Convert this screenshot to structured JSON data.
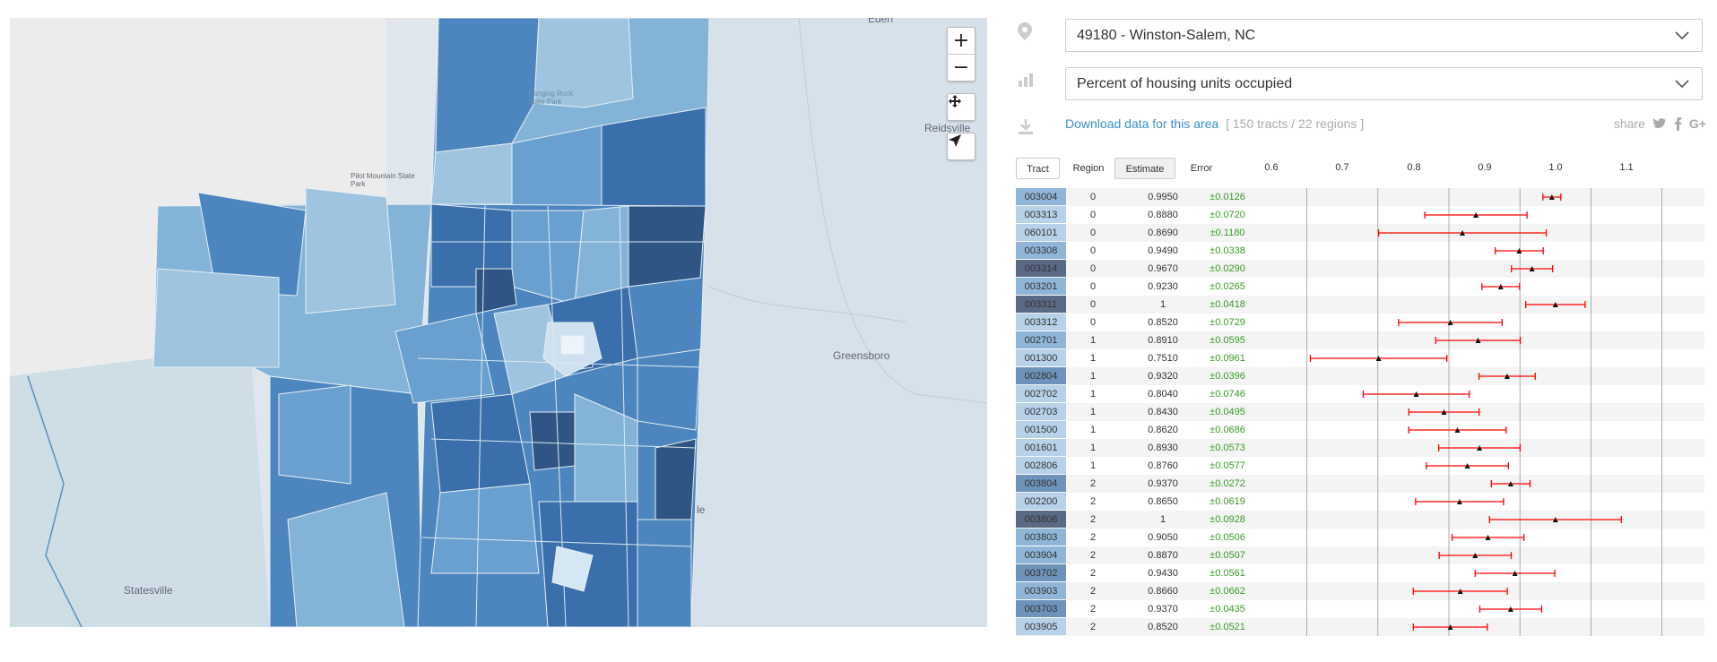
{
  "map": {
    "place_labels": [
      "Eden",
      "Reidsville",
      "Hanging Rock State Park",
      "Pilot Mountain State Park",
      "Greensboro",
      "Statesville",
      "le"
    ],
    "controls": {
      "zoom_in": "+",
      "zoom_out": "−"
    },
    "colors": {
      "water": "#d3e0e8",
      "land": "#e8e8e8",
      "c1": "#9ec4e0",
      "c2": "#84b3d8",
      "c3": "#6aa0cf",
      "c4": "#4d86bf",
      "c5": "#3a6fab",
      "c6": "#2e5584"
    }
  },
  "controls": {
    "location_select": "49180 - Winston-Salem, NC",
    "variable_select": "Percent of housing units occupied",
    "download_link": "Download data for this area",
    "download_meta": "[ 150 tracts / 22 regions ]",
    "share_label": "share",
    "share_icons": [
      "twitter-icon",
      "facebook-icon",
      "google-plus-icon"
    ]
  },
  "table": {
    "headers": {
      "tract": "Tract",
      "region": "Region",
      "estimate": "Estimate",
      "error": "Error"
    },
    "axis_ticks": [
      "0.6",
      "0.7",
      "0.8",
      "0.9",
      "1.0",
      "1.1"
    ],
    "rows": [
      {
        "tract": "003004",
        "region": "0",
        "estimate": "0.9950",
        "error": "±0.0126"
      },
      {
        "tract": "003313",
        "region": "0",
        "estimate": "0.8880",
        "error": "±0.0720"
      },
      {
        "tract": "060101",
        "region": "0",
        "estimate": "0.8690",
        "error": "±0.1180"
      },
      {
        "tract": "003308",
        "region": "0",
        "estimate": "0.9490",
        "error": "±0.0338"
      },
      {
        "tract": "003314",
        "region": "0",
        "estimate": "0.9670",
        "error": "±0.0290"
      },
      {
        "tract": "003201",
        "region": "0",
        "estimate": "0.9230",
        "error": "±0.0265"
      },
      {
        "tract": "003311",
        "region": "0",
        "estimate": "1",
        "error": "±0.0418"
      },
      {
        "tract": "003312",
        "region": "0",
        "estimate": "0.8520",
        "error": "±0.0729"
      },
      {
        "tract": "002701",
        "region": "1",
        "estimate": "0.8910",
        "error": "±0.0595"
      },
      {
        "tract": "001300",
        "region": "1",
        "estimate": "0.7510",
        "error": "±0.0961"
      },
      {
        "tract": "002804",
        "region": "1",
        "estimate": "0.9320",
        "error": "±0.0396"
      },
      {
        "tract": "002702",
        "region": "1",
        "estimate": "0.8040",
        "error": "±0.0746"
      },
      {
        "tract": "002703",
        "region": "1",
        "estimate": "0.8430",
        "error": "±0.0495"
      },
      {
        "tract": "001500",
        "region": "1",
        "estimate": "0.8620",
        "error": "±0.0686"
      },
      {
        "tract": "001601",
        "region": "1",
        "estimate": "0.8930",
        "error": "±0.0573"
      },
      {
        "tract": "002806",
        "region": "1",
        "estimate": "0.8760",
        "error": "±0.0577"
      },
      {
        "tract": "003804",
        "region": "2",
        "estimate": "0.9370",
        "error": "±0.0272"
      },
      {
        "tract": "002200",
        "region": "2",
        "estimate": "0.8650",
        "error": "±0.0619"
      },
      {
        "tract": "003806",
        "region": "2",
        "estimate": "1",
        "error": "±0.0928"
      },
      {
        "tract": "003803",
        "region": "2",
        "estimate": "0.9050",
        "error": "±0.0506"
      },
      {
        "tract": "003904",
        "region": "2",
        "estimate": "0.8870",
        "error": "±0.0507"
      },
      {
        "tract": "003702",
        "region": "2",
        "estimate": "0.9430",
        "error": "±0.0561"
      },
      {
        "tract": "003903",
        "region": "2",
        "estimate": "0.8660",
        "error": "±0.0662"
      },
      {
        "tract": "003703",
        "region": "2",
        "estimate": "0.9370",
        "error": "±0.0435"
      },
      {
        "tract": "003905",
        "region": "2",
        "estimate": "0.8520",
        "error": "±0.0521"
      }
    ],
    "tract_color_levels": [
      2,
      1,
      1,
      2,
      4,
      2,
      4,
      1,
      2,
      1,
      3,
      1,
      1,
      1,
      1,
      1,
      3,
      1,
      4,
      2,
      2,
      3,
      2,
      3,
      1
    ],
    "level_colors": [
      "#ffffff",
      "#b6d1e8",
      "#8fb6d8",
      "#6e93bb",
      "#5a6a85"
    ],
    "error_bar_color": "#ff0000"
  },
  "chart_data": {
    "type": "scatter",
    "x_axis_ticks": [
      0.6,
      0.7,
      0.8,
      0.9,
      1.0,
      1.1
    ],
    "xlim": [
      0.6,
      1.1
    ],
    "series": [
      {
        "estimates": [
          0.995,
          0.888,
          0.869,
          0.949,
          0.967,
          0.923,
          1,
          0.852,
          0.891,
          0.751,
          0.932,
          0.804,
          0.843,
          0.862,
          0.893,
          0.876,
          0.937,
          0.865,
          1,
          0.905,
          0.887,
          0.943,
          0.866,
          0.937,
          0.852
        ],
        "errors": [
          0.0126,
          0.072,
          0.118,
          0.0338,
          0.029,
          0.0265,
          0.0418,
          0.0729,
          0.0595,
          0.0961,
          0.0396,
          0.0746,
          0.0495,
          0.0686,
          0.0573,
          0.0577,
          0.0272,
          0.0619,
          0.0928,
          0.0506,
          0.0507,
          0.0561,
          0.0662,
          0.0435,
          0.0521
        ]
      }
    ]
  }
}
